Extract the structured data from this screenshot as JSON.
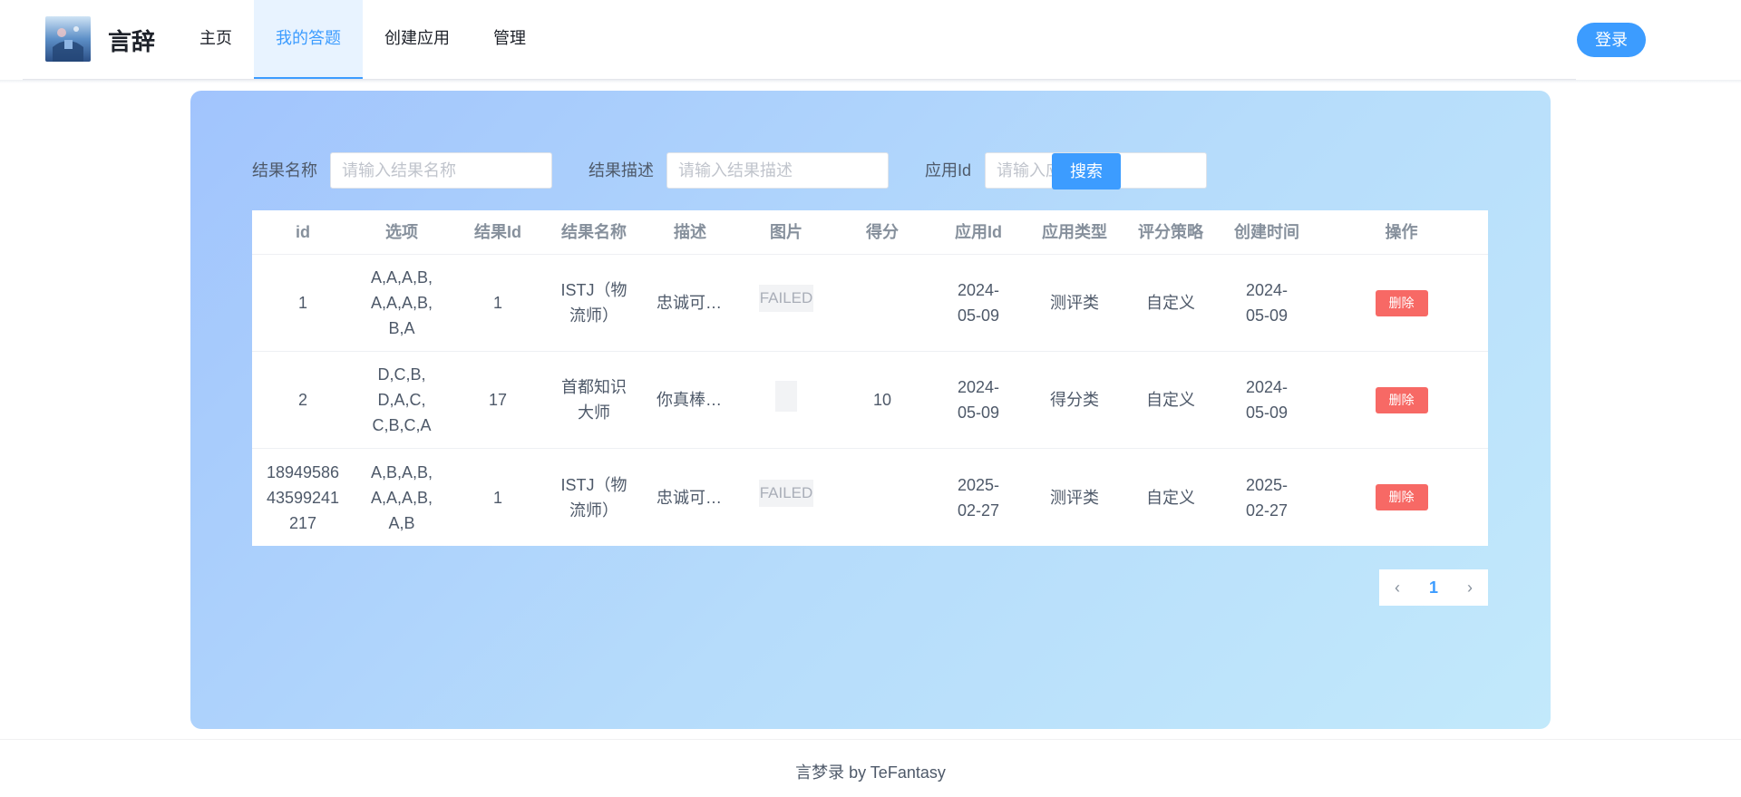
{
  "header": {
    "brand": "言辞",
    "nav": [
      "主页",
      "我的答题",
      "创建应用",
      "管理"
    ],
    "active_nav": "我的答题",
    "login_label": "登录"
  },
  "search": {
    "result_name_label": "结果名称",
    "result_name_placeholder": "请输入结果名称",
    "result_desc_label": "结果描述",
    "result_desc_placeholder": "请输入结果描述",
    "app_id_label": "应用Id",
    "app_id_placeholder": "请输入应用Id",
    "search_label": "搜索"
  },
  "table": {
    "columns": [
      "id",
      "选项",
      "结果Id",
      "结果名称",
      "描述",
      "图片",
      "得分",
      "应用Id",
      "应用类型",
      "评分策略",
      "创建时间",
      "操作"
    ],
    "rows": [
      {
        "id": "1",
        "options": "A,A,A,B,A,A,A,B,B,A",
        "result_id": "1",
        "result_name": "ISTJ（物流师）",
        "desc": "忠诚可靠，被公认为务实，注重细节。",
        "image": "FAILED",
        "score": "",
        "app_id": "2024-05-09",
        "app_type": "测评类",
        "scoring": "自定义",
        "created": "2024-05-09",
        "action": "删除"
      },
      {
        "id": "2",
        "options": "D,C,B,D,A,C,C,B,C,A",
        "result_id": "17",
        "result_name": "首都知识大师",
        "desc": "你真棒棒哦，首都知识非常出色！",
        "image": "",
        "score": "10",
        "app_id": "2024-05-09",
        "app_type": "得分类",
        "scoring": "自定义",
        "created": "2024-05-09",
        "action": "删除"
      },
      {
        "id": "1894958643599241217",
        "options": "A,B,A,B,A,A,A,B,A,B",
        "result_id": "1",
        "result_name": "ISTJ（物流师）",
        "desc": "忠诚可靠，被公认为务实，注重细节。",
        "image": "FAILED",
        "score": "",
        "app_id": "2025-02-27",
        "app_type": "测评类",
        "scoring": "自定义",
        "created": "2025-02-27",
        "action": "删除"
      }
    ]
  },
  "pagination": {
    "prev": "‹",
    "current": "1",
    "next": "›"
  },
  "footer": {
    "text": "言梦录 by TeFantasy"
  },
  "colors": {
    "primary": "#3c9cff",
    "danger": "#f76965",
    "card_start": "#a1c4fd",
    "card_end": "#c2e9fb"
  },
  "icons": {
    "logo": "app-logo-image",
    "prev": "chevron-left-icon",
    "next": "chevron-right-icon"
  }
}
